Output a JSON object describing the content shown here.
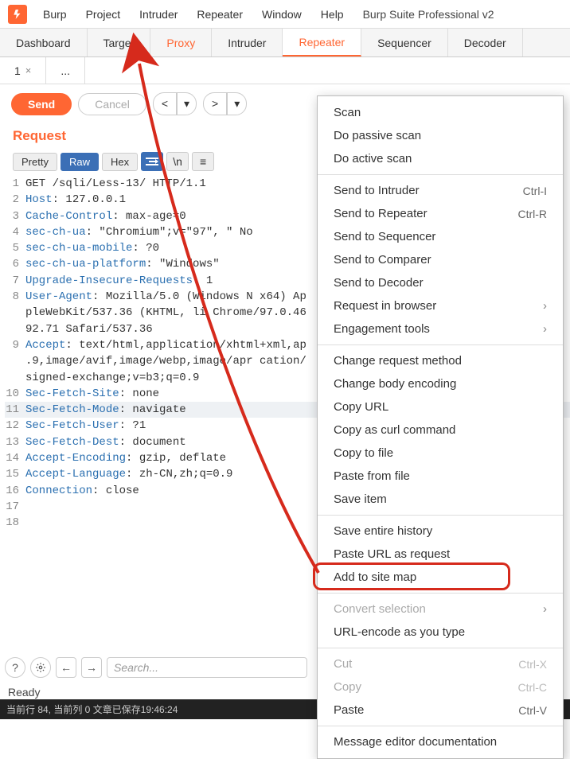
{
  "menubar": {
    "items": [
      "Burp",
      "Project",
      "Intruder",
      "Repeater",
      "Window",
      "Help"
    ],
    "app_title": "Burp Suite Professional v2"
  },
  "main_tabs": [
    "Dashboard",
    "Target",
    "Proxy",
    "Intruder",
    "Repeater",
    "Sequencer",
    "Decoder"
  ],
  "sub_tabs": {
    "first": "1",
    "more": "..."
  },
  "actions": {
    "send": "Send",
    "cancel": "Cancel",
    "back": "<",
    "fwd": ">"
  },
  "section": {
    "title": "Request"
  },
  "view_modes": [
    "Pretty",
    "Raw",
    "Hex"
  ],
  "request_lines": [
    {
      "n": 1,
      "raw": "GET /sqli/Less-13/ HTTP/1.1"
    },
    {
      "n": 2,
      "h": "Host",
      "v": "127.0.0.1"
    },
    {
      "n": 3,
      "h": "Cache-Control",
      "v": "max-age=0"
    },
    {
      "n": 4,
      "h": "sec-ch-ua",
      "v": "\"Chromium\";v=\"97\", \" No"
    },
    {
      "n": 5,
      "h": "sec-ch-ua-mobile",
      "v": "?0"
    },
    {
      "n": 6,
      "h": "sec-ch-ua-platform",
      "v": "\"Windows\""
    },
    {
      "n": 7,
      "h": "Upgrade-Insecure-Requests",
      "v": "1"
    },
    {
      "n": 8,
      "h": "User-Agent",
      "v": "Mozilla/5.0 (Windows N x64) AppleWebKit/537.36 (KHTML, li Chrome/97.0.4692.71 Safari/537.36"
    },
    {
      "n": 9,
      "h": "Accept",
      "v": "text/html,application/xhtml+xml,ap .9,image/avif,image/webp,image/apr cation/signed-exchange;v=b3;q=0.9"
    },
    {
      "n": 10,
      "h": "Sec-Fetch-Site",
      "v": "none"
    },
    {
      "n": 11,
      "h": "Sec-Fetch-Mode",
      "v": "navigate",
      "hl": true
    },
    {
      "n": 12,
      "h": "Sec-Fetch-User",
      "v": "?1"
    },
    {
      "n": 13,
      "h": "Sec-Fetch-Dest",
      "v": "document"
    },
    {
      "n": 14,
      "h": "Accept-Encoding",
      "v": "gzip, deflate"
    },
    {
      "n": 15,
      "h": "Accept-Language",
      "v": "zh-CN,zh;q=0.9"
    },
    {
      "n": 16,
      "h": "Connection",
      "v": "close"
    },
    {
      "n": 17,
      "raw": ""
    },
    {
      "n": 18,
      "raw": ""
    }
  ],
  "search": {
    "placeholder": "Search..."
  },
  "status": "Ready",
  "editor_status": "当前行 84, 当前列 0  文章已保存19:46:24",
  "context_menu": [
    {
      "label": "Scan"
    },
    {
      "label": "Do passive scan"
    },
    {
      "label": "Do active scan"
    },
    {
      "sep": true
    },
    {
      "label": "Send to Intruder",
      "shortcut": "Ctrl-I"
    },
    {
      "label": "Send to Repeater",
      "shortcut": "Ctrl-R"
    },
    {
      "label": "Send to Sequencer"
    },
    {
      "label": "Send to Comparer"
    },
    {
      "label": "Send to Decoder"
    },
    {
      "label": "Request in browser",
      "submenu": true
    },
    {
      "label": "Engagement tools",
      "submenu": true
    },
    {
      "sep": true
    },
    {
      "label": "Change request method"
    },
    {
      "label": "Change body encoding"
    },
    {
      "label": "Copy URL"
    },
    {
      "label": "Copy as curl command"
    },
    {
      "label": "Copy to file"
    },
    {
      "label": "Paste from file"
    },
    {
      "label": "Save item"
    },
    {
      "sep": true
    },
    {
      "label": "Save entire history"
    },
    {
      "label": "Paste URL as request"
    },
    {
      "label": "Add to site map",
      "highlight": true
    },
    {
      "sep": true
    },
    {
      "label": "Convert selection",
      "submenu": true,
      "disabled": true
    },
    {
      "label": "URL-encode as you type"
    },
    {
      "sep": true
    },
    {
      "label": "Cut",
      "shortcut": "Ctrl-X",
      "disabled": true
    },
    {
      "label": "Copy",
      "shortcut": "Ctrl-C",
      "disabled": true
    },
    {
      "label": "Paste",
      "shortcut": "Ctrl-V"
    },
    {
      "sep": true
    },
    {
      "label": "Message editor documentation"
    }
  ]
}
